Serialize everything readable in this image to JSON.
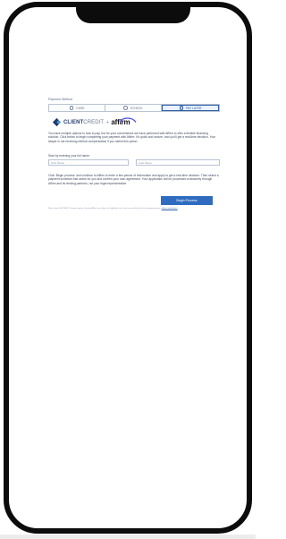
{
  "payment": {
    "section_label": "Payment Method",
    "tabs": [
      {
        "label": "CARD",
        "selected": false
      },
      {
        "label": "ECHECK",
        "selected": false
      },
      {
        "label": "PAY LATER",
        "selected": true
      }
    ]
  },
  "brand": {
    "clientcredit_bold": "CLIENT",
    "clientcredit_light": "CREDIT",
    "plus": "+",
    "affirm": "affirm",
    "clientcredit_color": "#223a70",
    "affirm_arc_color": "#4a4af4"
  },
  "intro_text": "You have multiple options in how to pay, but for your convenience we have partnered with Affirm to offer a flexible financing solution. Click below to begin completing your payment with Affirm. It's quick and secure, and you'll get a real-time decision. Your lawyer is not receiving referral compensation if you select this option.",
  "name_prompt": "Start by entering your full name:",
  "first_name": {
    "placeholder": "First Name",
    "value": ""
  },
  "last_name": {
    "placeholder": "Last Name",
    "value": ""
  },
  "process_text": "Click 'Begin process' and continue to Affirm to enter a few pieces of information and apply to get a real-time decision. Then select a payment schedule that works for you and confirm your loan agreement. Your application will be processed exclusively through Affirm and its lending partners, not your legal representative.",
  "begin_button": "Begin Process",
  "footnote": "Rates from 0-30% APR. Payment options through Affirm are subject to eligibility check and are provided by these lending partners:",
  "footnote_link": "affirm.com/lenders",
  "accent_color": "#2f6cc0"
}
